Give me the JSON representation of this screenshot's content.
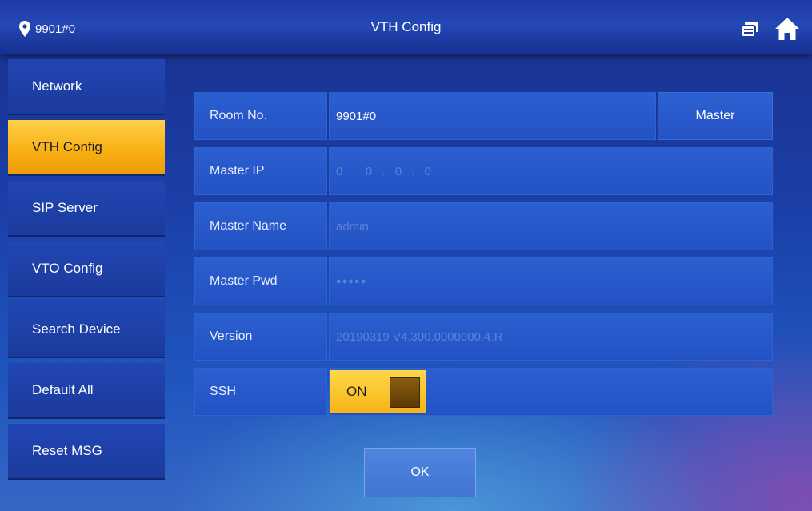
{
  "header": {
    "location": "9901#0",
    "title": "VTH Config",
    "location_icon": "map-pin-icon",
    "right_icons": [
      "message-icon",
      "home-icon"
    ]
  },
  "sidebar": {
    "items": [
      {
        "label": "Network",
        "active": false
      },
      {
        "label": "VTH Config",
        "active": true
      },
      {
        "label": "SIP Server",
        "active": false
      },
      {
        "label": "VTO Config",
        "active": false
      },
      {
        "label": "Search Device",
        "active": false
      },
      {
        "label": "Default All",
        "active": false
      },
      {
        "label": "Reset MSG",
        "active": false
      }
    ]
  },
  "form": {
    "room_no": {
      "label": "Room No.",
      "value": "9901#0",
      "button": "Master"
    },
    "master_ip": {
      "label": "Master IP",
      "value": "0 . 0 . 0 . 0"
    },
    "master_name": {
      "label": "Master Name",
      "value": "admin"
    },
    "master_pwd": {
      "label": "Master Pwd",
      "value": "●●●●●"
    },
    "version": {
      "label": "Version",
      "value": "20190319 V4.300.0000000.4.R"
    },
    "ssh": {
      "label": "SSH",
      "value": "ON"
    }
  },
  "actions": {
    "ok_label": "OK"
  },
  "colors": {
    "active_tab": "#f7ae12",
    "background": "#1b3fa8",
    "toggle_on": "#ffd84a"
  }
}
